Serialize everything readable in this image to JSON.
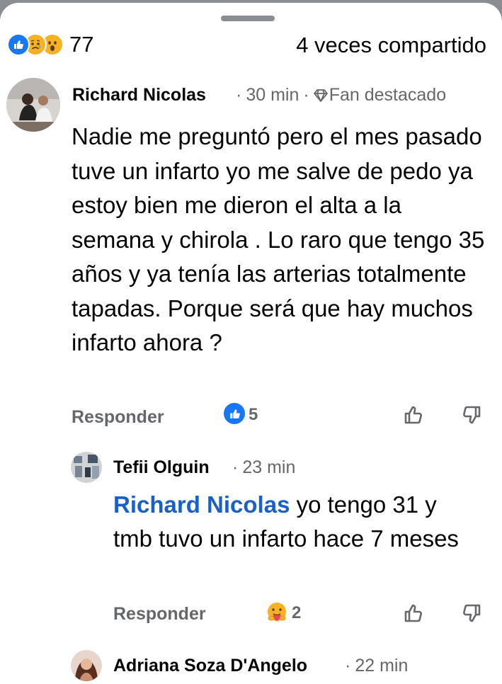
{
  "header": {
    "reaction_icons": [
      "like-icon",
      "sad-icon",
      "wow-icon"
    ],
    "reaction_count": "77",
    "shares": "4 veces compartido"
  },
  "comments": [
    {
      "author": "Richard Nicolas",
      "time": "30 min",
      "badge": "Fan destacado",
      "text": "Nadie me preguntó pero el mes pasado tuve un infarto yo me salve de pedo ya estoy bien me dieron el alta a la semana y chirola . Lo raro que tengo 35 años y ya tenía las arterias totalmente tapadas. Porque será que hay muchos infarto ahora ?",
      "reply_label": "Responder",
      "reaction_icon": "like-icon",
      "reaction_count": "5"
    },
    {
      "author": "Tefii Olguin",
      "time": "23 min",
      "mention": "Richard Nicolas",
      "text_line1": "yo tengo 31 y",
      "text_rest": "tmb tuvo un infarto hace 7 meses",
      "reply_label": "Responder",
      "reaction_icon": "care-icon",
      "reaction_count": "2"
    },
    {
      "author": "Adriana Soza D'Angelo",
      "time": "22 min"
    }
  ],
  "colors": {
    "like_blue": "#1877f2",
    "mention_blue": "#1b60c9",
    "muted": "#65676b",
    "emoji_yellow": "#f7b125"
  }
}
